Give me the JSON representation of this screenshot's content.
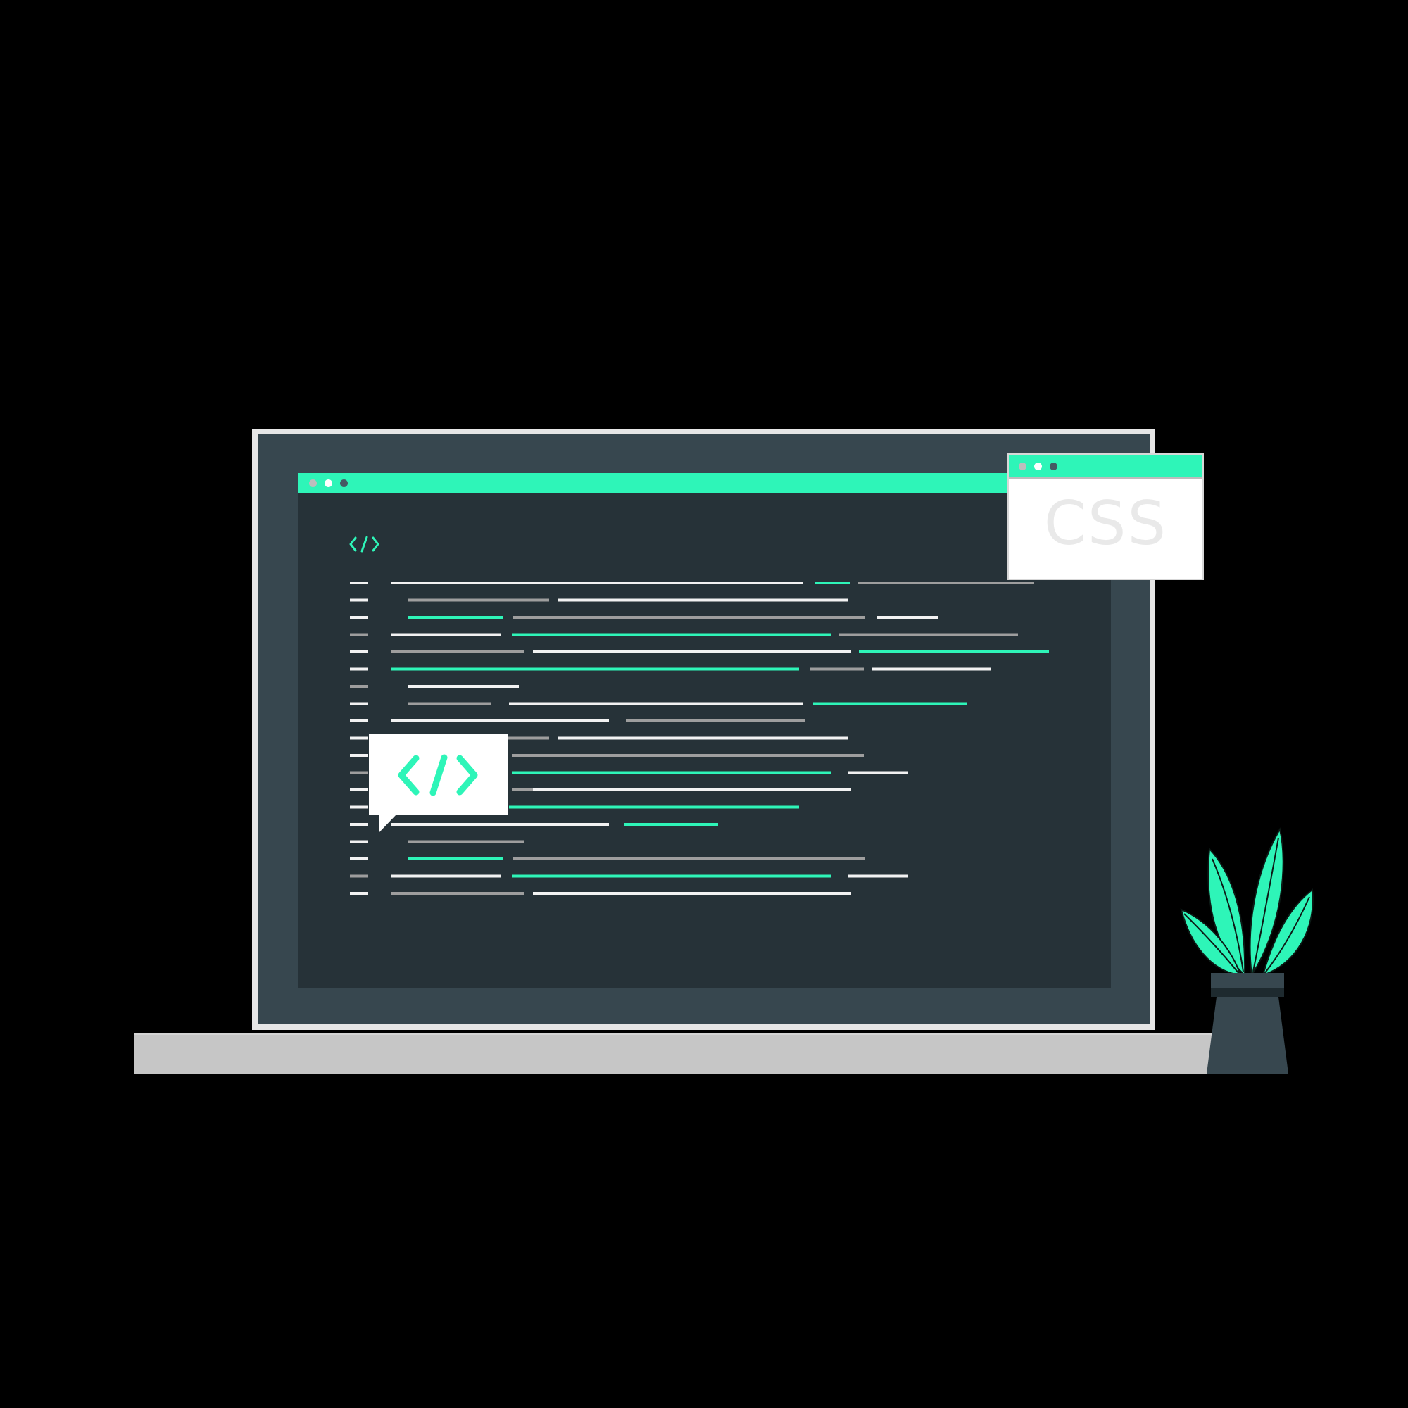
{
  "colors": {
    "background": "#000000",
    "accent": "#2ef5b8",
    "bezel": "#37474f",
    "editor_bg": "#263238",
    "frame": "#e6e6e6",
    "base": "#c6c6c6",
    "code_white": "#f2f2f2",
    "code_gray": "#9e9e9e",
    "pot": "#2b3a40"
  },
  "editor": {
    "titlebar_dots": [
      "#bdbdbd",
      "#ffffff",
      "#455a64"
    ],
    "header_icon": "code-tag-icon",
    "code_lines": [
      [
        {
          "c": "white"
        },
        {
          "c": "white"
        },
        {
          "c": "green"
        },
        {
          "c": "gray"
        }
      ],
      [
        {
          "c": "white"
        },
        {
          "c": "gray"
        },
        {
          "c": "white"
        }
      ],
      [
        {
          "c": "white"
        },
        {
          "c": "green"
        },
        {
          "c": "gray"
        },
        {
          "c": "white"
        }
      ],
      [
        {
          "c": "gray"
        },
        {
          "c": "white"
        },
        {
          "c": "green"
        },
        {
          "c": "gray"
        }
      ],
      [
        {
          "c": "white"
        },
        {
          "c": "gray"
        },
        {
          "c": "white"
        },
        {
          "c": "green"
        }
      ],
      [
        {
          "c": "white"
        },
        {
          "c": "green"
        },
        {
          "c": "gray"
        },
        {
          "c": "white"
        }
      ],
      [
        {
          "c": "gray"
        },
        {
          "c": "white"
        }
      ],
      [
        {
          "c": "white"
        },
        {
          "c": "gray"
        },
        {
          "c": "white"
        },
        {
          "c": "green"
        }
      ],
      [
        {
          "c": "white"
        },
        {
          "c": "white"
        },
        {
          "c": "gray"
        }
      ],
      [
        {
          "c": "white"
        },
        {
          "c": "gray"
        },
        {
          "c": "white"
        }
      ],
      [
        {
          "c": "white"
        },
        {
          "c": "gray"
        }
      ],
      [
        {
          "c": "gray"
        },
        {
          "c": "green"
        },
        {
          "c": "white"
        }
      ],
      [
        {
          "c": "white"
        },
        {
          "c": "gray"
        },
        {
          "c": "white"
        }
      ],
      [
        {
          "c": "white"
        },
        {
          "c": "green"
        }
      ],
      [
        {
          "c": "white"
        },
        {
          "c": "white"
        },
        {
          "c": "green"
        }
      ],
      [
        {
          "c": "white"
        },
        {
          "c": "gray"
        }
      ],
      [
        {
          "c": "white"
        },
        {
          "c": "green"
        },
        {
          "c": "gray"
        }
      ],
      [
        {
          "c": "gray"
        },
        {
          "c": "white"
        },
        {
          "c": "green"
        },
        {
          "c": "white"
        }
      ],
      [
        {
          "c": "white"
        },
        {
          "c": "gray"
        },
        {
          "c": "white"
        }
      ]
    ]
  },
  "bubble": {
    "icon": "code-tag-icon"
  },
  "css_window": {
    "titlebar_dots": [
      "#bdbdbd",
      "#ffffff",
      "#455a64"
    ],
    "label": "CSS"
  },
  "plant": {
    "icon": "potted-plant-icon"
  }
}
